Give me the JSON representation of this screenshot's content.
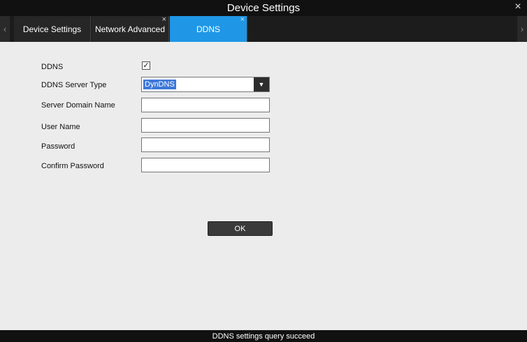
{
  "window": {
    "title": "Device Settings",
    "close_glyph": "×"
  },
  "tabs": [
    {
      "label": "Device Settings",
      "closable": false
    },
    {
      "label": "Network Advanced",
      "closable": true,
      "close_glyph": "×"
    },
    {
      "label": "DDNS",
      "closable": true,
      "close_glyph": "×",
      "active": true
    }
  ],
  "tab_nav": {
    "left_glyph": "‹",
    "right_glyph": "›"
  },
  "form": {
    "ddns_label": "DDNS",
    "ddns_checked": true,
    "check_glyph": "✓",
    "server_type_label": "DDNS Server Type",
    "server_type_value": "DynDNS",
    "dropdown_glyph": "▼",
    "domain_label": "Server Domain Name",
    "domain_value": "",
    "username_label": "User Name",
    "username_value": "",
    "password_label": "Password",
    "password_value": "",
    "confirm_label": "Confirm Password",
    "confirm_value": ""
  },
  "ok_label": "OK",
  "status": "DDNS settings query succeed",
  "colors": {
    "accent": "#1f97e6",
    "titlebar": "#111111",
    "tabbar": "#1c1c1c",
    "panel": "#ececec",
    "selection": "#3d78d8"
  }
}
